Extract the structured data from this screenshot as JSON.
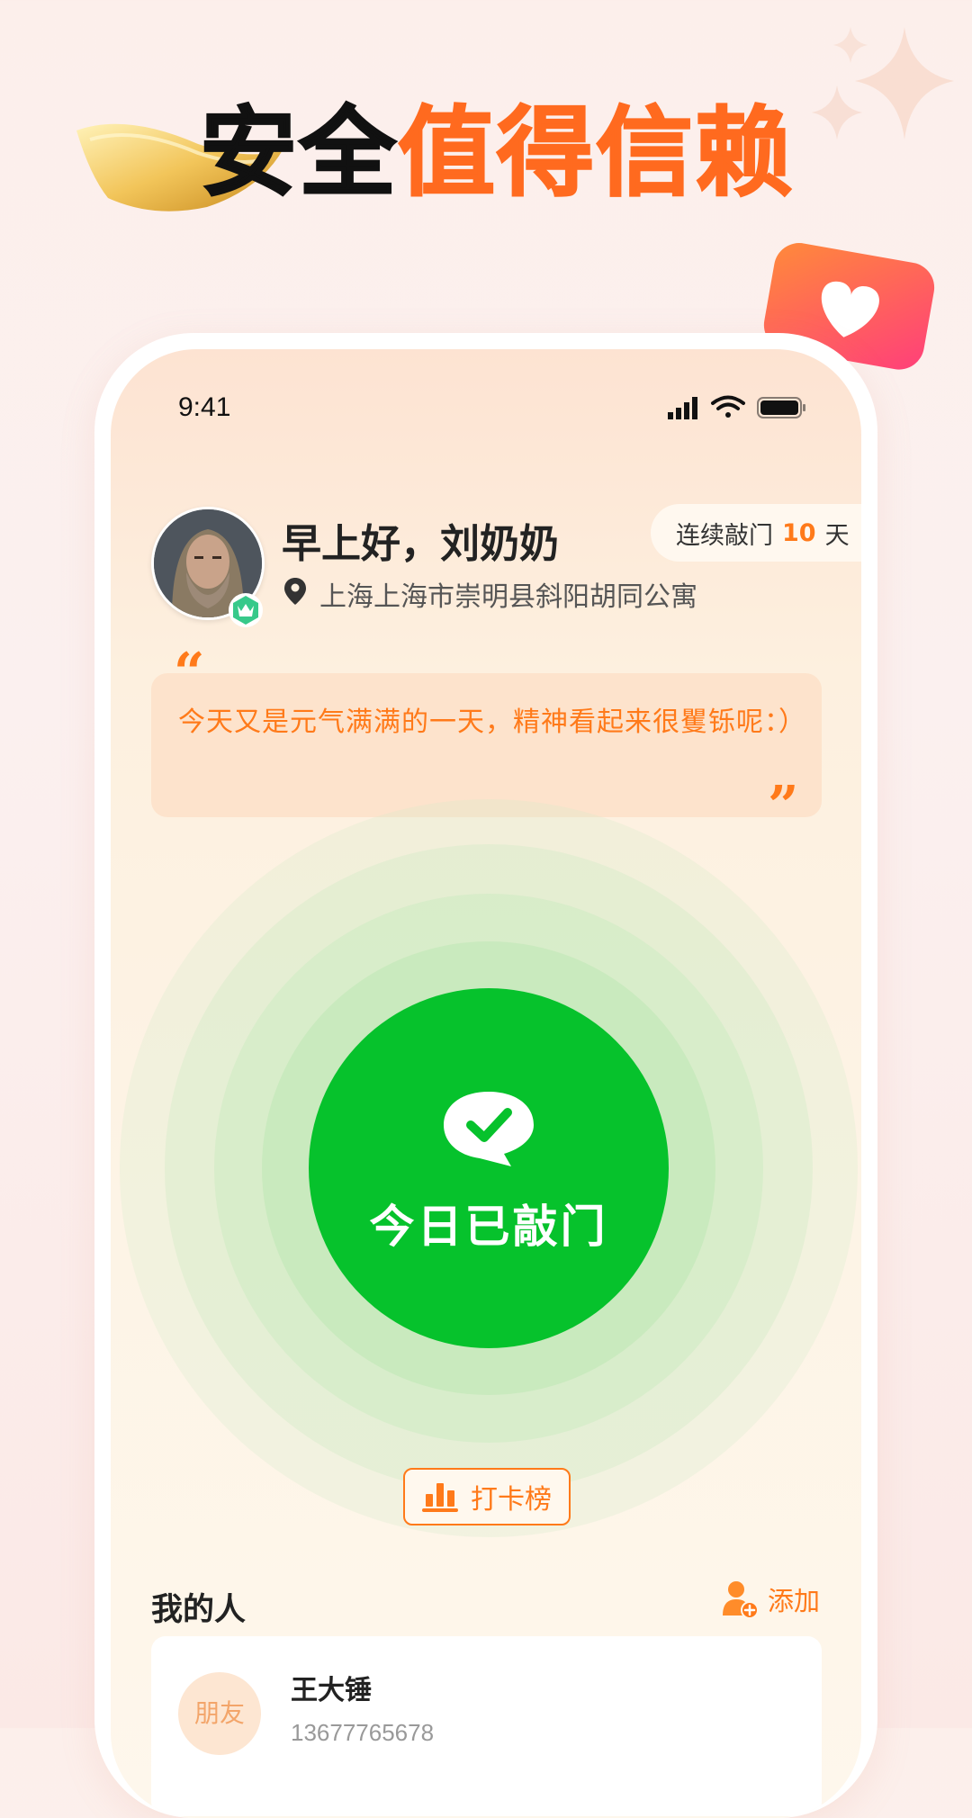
{
  "headline": {
    "part1": "安全",
    "part2": "值得信赖"
  },
  "status_bar": {
    "time": "9:41"
  },
  "profile": {
    "greeting": "早上好，刘奶奶",
    "location": "上海上海市崇明县斜阳胡同公寓"
  },
  "streak": {
    "prefix": "连续敲门",
    "count": "10",
    "suffix": "天"
  },
  "quote": {
    "text": "今天又是元气满满的一天，精神看起来很矍铄呢：）"
  },
  "knock": {
    "label": "今日已敲门"
  },
  "ranking": {
    "label": "打卡榜"
  },
  "people": {
    "title": "我的人",
    "add_label": "添加",
    "contacts": [
      {
        "relation": "朋友",
        "name": "王大锤",
        "phone": "13677765678"
      }
    ]
  },
  "colors": {
    "accent": "#ff7a1a",
    "success": "#06c22c",
    "headline_orange": "#ff6a1f"
  }
}
